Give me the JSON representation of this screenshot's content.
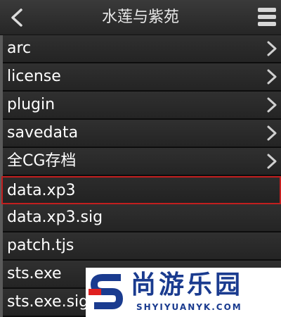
{
  "header": {
    "title": "水莲与紫苑",
    "back_icon": "chevron-left-icon",
    "menu_icon": "hamburger-menu-icon"
  },
  "list": {
    "items": [
      {
        "label": "arc",
        "type": "folder"
      },
      {
        "label": "license",
        "type": "folder"
      },
      {
        "label": "plugin",
        "type": "folder"
      },
      {
        "label": "savedata",
        "type": "folder"
      },
      {
        "label": "全CG存档",
        "type": "folder"
      },
      {
        "label": "data.xp3",
        "type": "file",
        "selected": true
      },
      {
        "label": "data.xp3.sig",
        "type": "file"
      },
      {
        "label": "patch.tjs",
        "type": "file"
      },
      {
        "label": "sts.exe",
        "type": "file"
      },
      {
        "label": "sts.exe.sig",
        "type": "file"
      }
    ]
  },
  "watermark": {
    "brand_cn": "尚游乐园",
    "brand_en": "SHYIYUANYK.COM"
  },
  "colors": {
    "selection_border": "#c21f1f",
    "watermark_blue": "#1a3b8f",
    "watermark_red": "#e02020"
  }
}
